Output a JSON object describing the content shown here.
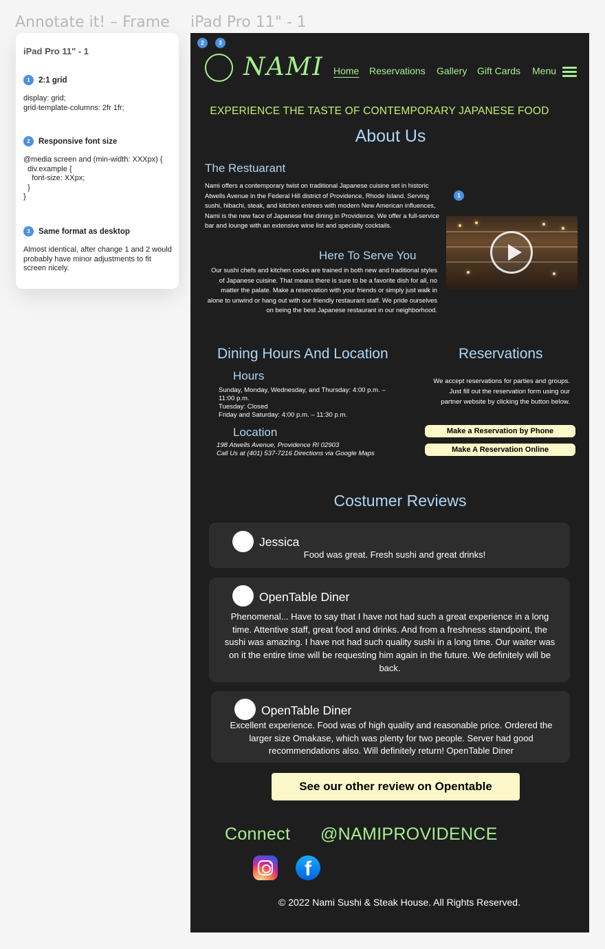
{
  "canvas": {
    "annot_frame_label": "Annotate it! – Frame",
    "ipad_frame_label": "iPad Pro 11\" - 1"
  },
  "annotations": {
    "title": "iPad Pro 11\" - 1",
    "items": [
      {
        "num": "1",
        "title": "2:1 grid",
        "body": "display: grid;\ngrid-template-columns: 2fr 1fr;"
      },
      {
        "num": "2",
        "title": "Responsive font size",
        "body": "@media screen and (min-width: XXXpx) {\n  div.example {\n    font-size: XXpx;\n  }\n}"
      },
      {
        "num": "3",
        "title": "Same format as desktop",
        "body": "Almost identical, after change 1 and 2 would probably have minor adjustments to fit screen nicely."
      }
    ]
  },
  "markers": {
    "m2": "2",
    "m3": "3",
    "m1": "1"
  },
  "header": {
    "logo": "NAMI",
    "nav": [
      "Home",
      "Reservations",
      "Gallery",
      "Gift Cards",
      "Menu"
    ]
  },
  "hero": {
    "tagline": "EXPERIENCE THE TASTE OF CONTEMPORARY JAPANESE FOOD"
  },
  "about": {
    "title": "About Us",
    "restaurant_title": "The Restuarant",
    "restaurant_text": "Nami offers a contemporary twist on traditional Japanese cuisine set in historic Atwells Avenue in the Federal Hill district of Providence, Rhode Island. Serving sushi, hibachi, steak, and kitchen entrees with modern New American influences, Nami is the new face of Japanese fine dining in Providence. We offer a full-service bar and lounge with an extensive wine list and specialty cocktails.",
    "serve_title": "Here To Serve You",
    "serve_text": "Our sushi chefs and kitchen cooks are trained in both new and traditional styles of Japanese cuisine. That means there is sure to be a favorite dish for all, no matter the palate. Make a reservation with your friends or simply just walk in alone to unwind or hang out with our friendly restaurant staff. We pride ourselves on being the best Japanese restaurant in our neighborhood."
  },
  "dining": {
    "title": "Dining Hours And Location",
    "hours_title": "Hours",
    "hours_text": "Sunday, Monday, Wednesday, and Thursday: 4:00 p.m. – 11:00 p.m.\nTuesday: Closed\nFriday and Saturday: 4:00 p.m. – 11:30 p.m.",
    "location_title": "Location",
    "location_text": "198 Atwells Avenue, Providence RI 02903\nCall Us at (401) 537-7216 Directions via Google Maps"
  },
  "reservations": {
    "title": "Reservations",
    "text": "We accept reservations for parties and groups. Just fill out the reservation form using our partner website by clicking the button below.",
    "phone_button": "Make a Reservation by Phone",
    "online_button": "Make A Reservation Online"
  },
  "reviews": {
    "title": "Costumer Reviews",
    "items": [
      {
        "name": "Jessica",
        "text": "Food was great. Fresh sushi and great drinks!"
      },
      {
        "name": "OpenTable Diner",
        "text": "Phenomenal... Have to say that I have not had such a great experience in a long time. Attentive staff, great food and drinks. And from a freshness standpoint, the sushi was amazing. I have not had such quality sushi in a long time. Our waiter was on it the entire time will be requesting him again in the future. We definitely will be back."
      },
      {
        "name": "OpenTable Diner",
        "text": "Excellent experience. Food was of high quality and reasonable price. Ordered the larger size Omakase, which was plenty for two people. Server had good recommendations also. Will definitely return! OpenTable Diner"
      }
    ],
    "other_button": "See our other review on Opentable"
  },
  "connect": {
    "label": "Connect",
    "handle": "@NAMIPROVIDENCE",
    "icons": [
      "instagram-icon",
      "facebook-icon"
    ],
    "facebook_glyph": "f"
  },
  "footer": {
    "text": "© 2022 Nami Sushi & Steak House. All Rights Reserved."
  },
  "colors": {
    "background": "#1e1e1e",
    "accent_green": "#a6ef8f",
    "heading_blue": "#aed6f5",
    "button_cream": "#fdf8c9",
    "review_card": "#2d2d2d",
    "annotation_blue": "#4a90e2"
  }
}
